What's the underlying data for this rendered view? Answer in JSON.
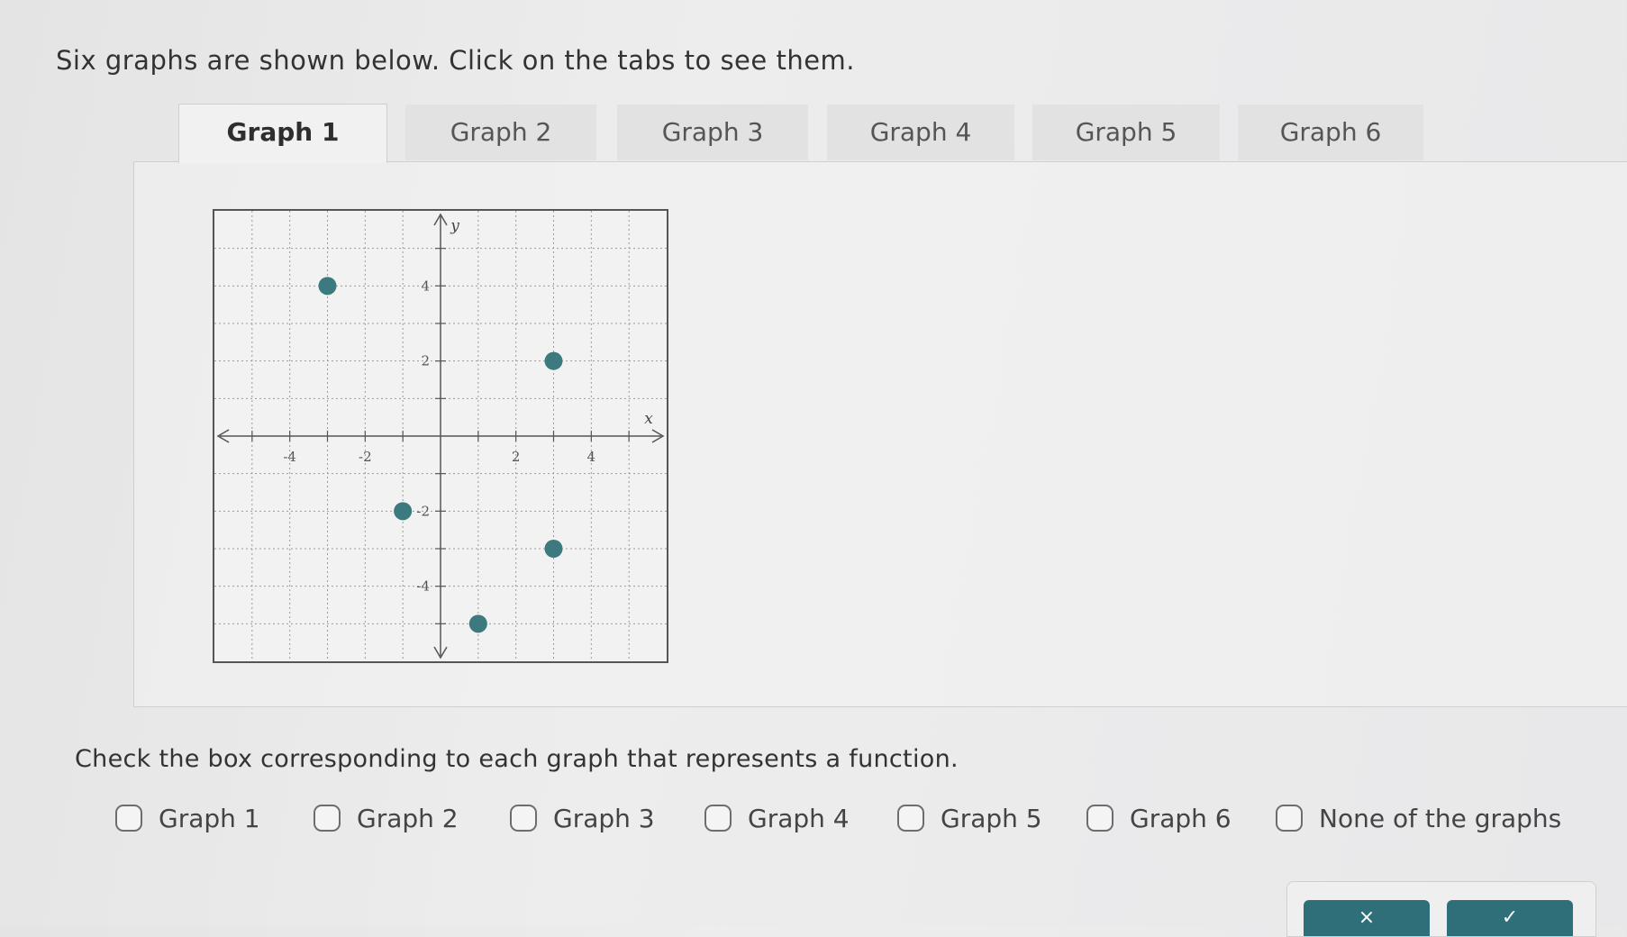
{
  "instruction": "Six graphs are shown below. Click on the tabs to see them.",
  "tabs": [
    {
      "label": "Graph 1",
      "active": true
    },
    {
      "label": "Graph 2",
      "active": false
    },
    {
      "label": "Graph 3",
      "active": false
    },
    {
      "label": "Graph 4",
      "active": false
    },
    {
      "label": "Graph 5",
      "active": false
    },
    {
      "label": "Graph 6",
      "active": false
    }
  ],
  "chart_data": {
    "type": "scatter",
    "xlabel": "x",
    "ylabel": "y",
    "xlim": [
      -6,
      6
    ],
    "ylim": [
      -6,
      6
    ],
    "grid": true,
    "x_ticks": [
      "-4",
      "-2",
      "2",
      "4"
    ],
    "y_ticks": [
      "4",
      "2",
      "-2",
      "-4"
    ],
    "points": [
      {
        "x": -3,
        "y": 4
      },
      {
        "x": 3,
        "y": 2
      },
      {
        "x": -1,
        "y": -2
      },
      {
        "x": 3,
        "y": -3
      },
      {
        "x": 1,
        "y": -5
      }
    ],
    "point_color": "#3d7a80"
  },
  "question": "Check the box corresponding to each graph that represents a function.",
  "options": [
    "Graph 1",
    "Graph 2",
    "Graph 3",
    "Graph 4",
    "Graph 5",
    "Graph 6",
    "None of the graphs"
  ],
  "buttons": {
    "clear_symbol": "×",
    "check_symbol": "✓"
  },
  "colors": {
    "accent": "#2f6f79"
  }
}
